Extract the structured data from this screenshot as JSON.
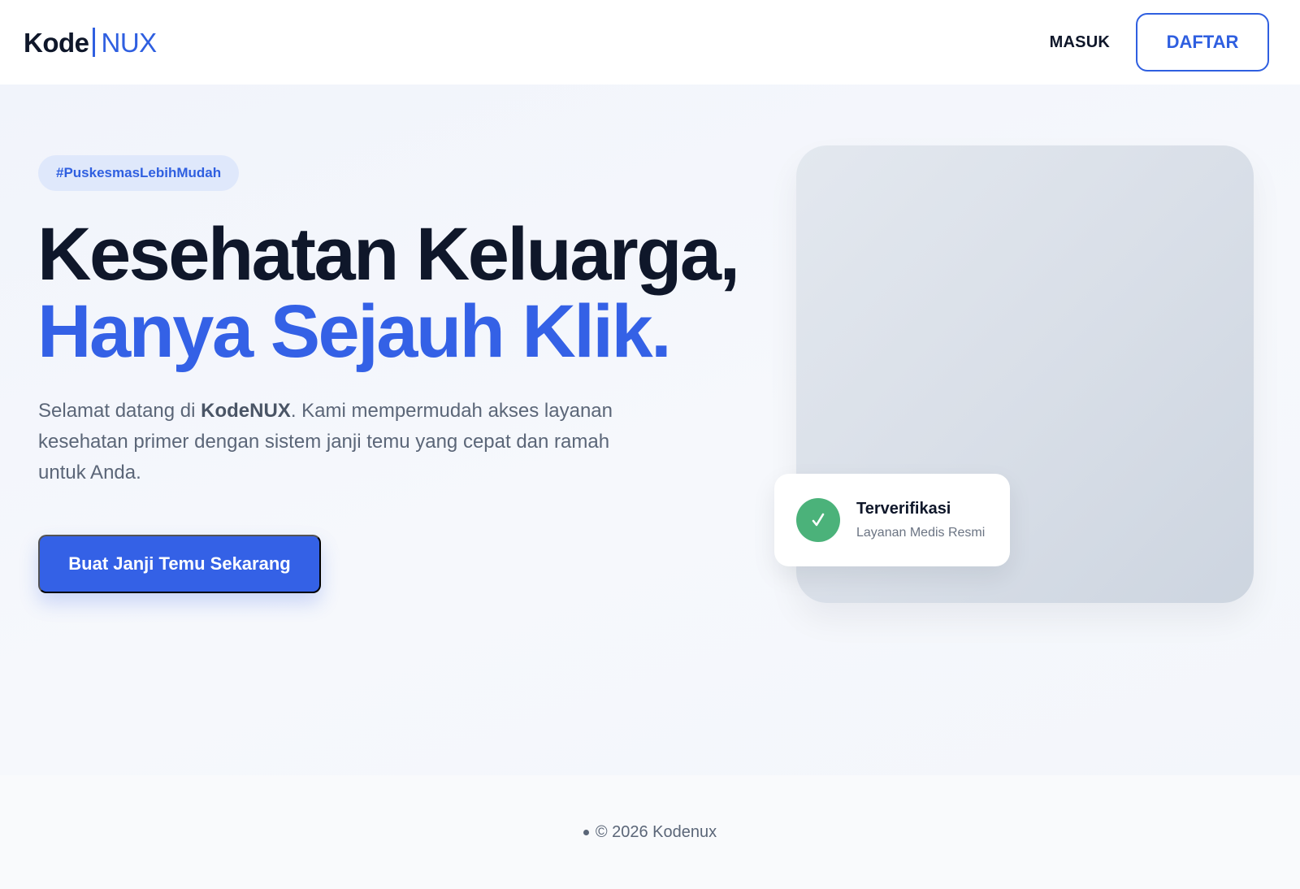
{
  "header": {
    "logo_bold": "Kode",
    "logo_light": "NUX",
    "nav": {
      "login_label": "MASUK",
      "register_label": "DAFTAR"
    }
  },
  "hero": {
    "tag": "#PuskesmasLebihMudah",
    "title_line1": "Kesehatan Keluarga,",
    "title_line2": "Hanya Sejauh Klik.",
    "description": {
      "prefix": "Selamat datang di ",
      "brand": "KodeNUX",
      "suffix": ". Kami mempermudah akses layanan kesehatan primer dengan sistem janji temu yang cepat dan ramah untuk Anda."
    },
    "cta_label": "Buat Janji Temu Sekarang",
    "verified_card": {
      "title": "Terverifikasi",
      "subtitle": "Layanan Medis Resmi",
      "icon": "check-icon"
    }
  },
  "footer": {
    "copyright": "© 2026 Kodenux"
  },
  "colors": {
    "accent": "#3461e6",
    "heading": "#0f172a",
    "success": "#4bb27a",
    "tag_bg": "#dfe8fb"
  }
}
